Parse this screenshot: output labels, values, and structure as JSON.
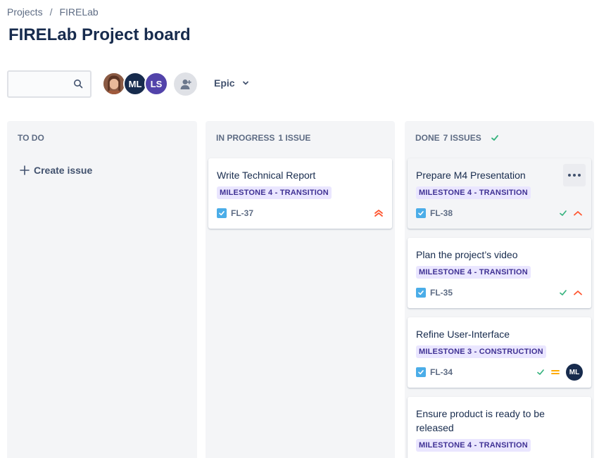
{
  "breadcrumb": {
    "projects": "Projects",
    "separator": "/",
    "current": "FIRELab"
  },
  "page_title": "FIRELab Project board",
  "search": {
    "placeholder": ""
  },
  "avatars": [
    {
      "initials": "",
      "kind": "photo"
    },
    {
      "initials": "ML",
      "color": "#172b4d"
    },
    {
      "initials": "LS",
      "color": "#5243aa"
    }
  ],
  "filter": {
    "epic_label": "Epic"
  },
  "columns": {
    "todo": {
      "title": "TO DO",
      "create_label": "Create issue"
    },
    "inprogress": {
      "title": "IN PROGRESS",
      "count": "1 ISSUE"
    },
    "done": {
      "title": "DONE",
      "count": "7 ISSUES"
    }
  },
  "cards": {
    "fl37": {
      "title": "Write Technical Report",
      "epic": "MILESTONE 4 - TRANSITION",
      "key": "FL-37",
      "priority": "highest"
    },
    "fl38": {
      "title": "Prepare M4 Presentation",
      "epic": "MILESTONE 4 - TRANSITION",
      "key": "FL-38",
      "priority": "high"
    },
    "fl35": {
      "title": "Plan the project’s video",
      "epic": "MILESTONE 4 - TRANSITION",
      "key": "FL-35",
      "priority": "high"
    },
    "fl34": {
      "title": "Refine User-Interface",
      "epic": "MILESTONE 3 - CONSTRUCTION",
      "key": "FL-34",
      "priority": "medium",
      "assignee": "ML"
    },
    "fl_next": {
      "title": "Ensure product is ready to be released",
      "epic": "MILESTONE 4 - TRANSITION"
    }
  },
  "colors": {
    "epic_bg": "#eae6ff",
    "epic_text": "#403294",
    "priority_high": "#ff5630",
    "priority_medium": "#ffab00",
    "done_check": "#36b37e",
    "story_check": "#4bade8"
  }
}
